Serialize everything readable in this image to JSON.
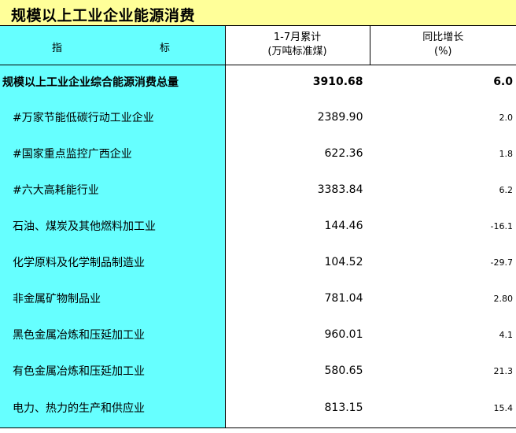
{
  "title": "规模以上工业企业能源消费",
  "header": {
    "indicator_left": "指",
    "indicator_right": "标",
    "cumulative_line1": "1-7月累计",
    "cumulative_line2": "(万吨标准煤)",
    "yoy_line1": "同比增长",
    "yoy_line2": "(%)"
  },
  "rows": [
    {
      "name": "规模以上工业企业综合能源消费总量",
      "value": "3910.68",
      "yoy": "6.0"
    },
    {
      "name": "#万家节能低碳行动工业企业",
      "value": "2389.90",
      "yoy": "2.0"
    },
    {
      "name": "#国家重点监控广西企业",
      "value": "622.36",
      "yoy": "1.8"
    },
    {
      "name": "#六大高耗能行业",
      "value": "3383.84",
      "yoy": "6.2"
    },
    {
      "name": "石油、煤炭及其他燃料加工业",
      "value": "144.46",
      "yoy": "-16.1"
    },
    {
      "name": "化学原料及化学制品制造业",
      "value": "104.52",
      "yoy": "-29.7"
    },
    {
      "name": "非金属矿物制品业",
      "value": "781.04",
      "yoy": "2.80"
    },
    {
      "name": "黑色金属冶炼和压延加工业",
      "value": "960.01",
      "yoy": "4.1"
    },
    {
      "name": "有色金属冶炼和压延加工业",
      "value": "580.65",
      "yoy": "21.3"
    },
    {
      "name": "电力、热力的生产和供应业",
      "value": "813.15",
      "yoy": "15.4"
    }
  ],
  "colors": {
    "title_background": "#ffff99",
    "indicator_column": "#66ffff"
  }
}
